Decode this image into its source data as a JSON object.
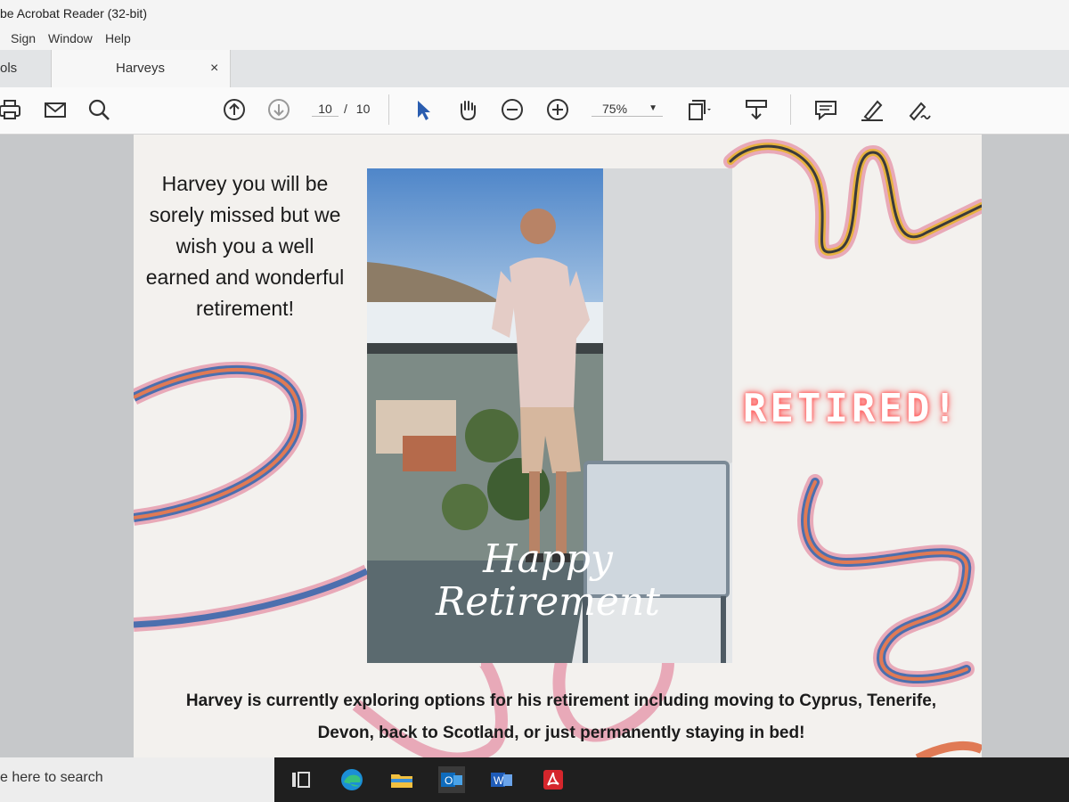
{
  "window": {
    "title": "be Acrobat Reader (32-bit)"
  },
  "menu": {
    "items": [
      "Sign",
      "Window",
      "Help"
    ]
  },
  "tabs": [
    {
      "label": "ols"
    },
    {
      "label": "Harveys"
    }
  ],
  "tab_close": "×",
  "toolbar": {
    "page_current": "10",
    "page_sep": "/",
    "page_total": "10",
    "zoom": "75%",
    "icons": [
      "print-icon",
      "mail-icon",
      "search-icon",
      "page-up-icon",
      "page-down-icon",
      "select-cursor-icon",
      "hand-icon",
      "zoom-out-icon",
      "zoom-in-icon",
      "fit-page-icon",
      "scroll-mode-icon",
      "comment-icon",
      "highlight-pen-icon",
      "sign-icon"
    ]
  },
  "document": {
    "intro_text": "Harvey you will be sorely missed but we wish you a well earned and wonderful retirement!",
    "photo_text_line1": "Happy",
    "photo_text_line2": "Retirement",
    "retired_label": "RETIRED!",
    "caption": "Harvey is currently exploring options for his retirement including moving to Cyprus, Tenerife, Devon, back to Scotland, or just permanently staying in bed!",
    "colors": {
      "stripe_pink": "#e8a9b8",
      "stripe_blue": "#4c6fae",
      "stripe_orange": "#e07a55",
      "stripe_gold": "#e7b23f",
      "stripe_dark": "#3a3a3a",
      "neon": "#ff5a5a"
    }
  },
  "taskbar": {
    "search_placeholder": "e here to search",
    "apps": [
      "task-view-icon",
      "edge-icon",
      "file-explorer-icon",
      "outlook-icon",
      "word-icon",
      "acrobat-icon"
    ]
  }
}
